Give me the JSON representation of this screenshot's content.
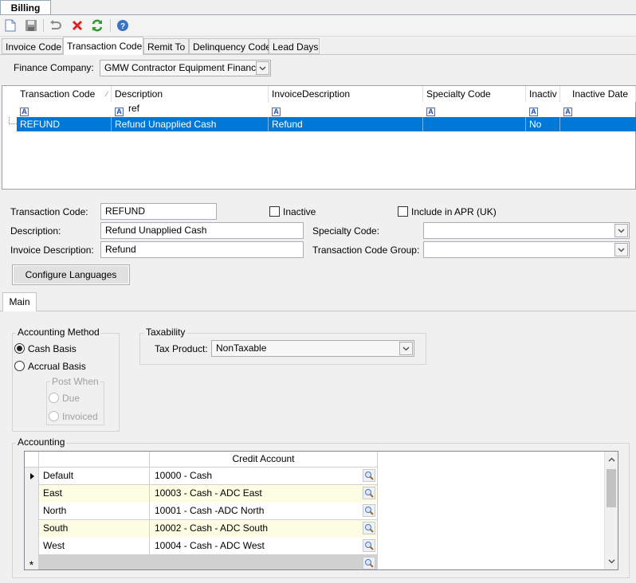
{
  "document_tab": "Billing",
  "toolbar": {
    "icons": [
      "new-icon",
      "save-icon",
      "undo-icon",
      "delete-icon",
      "refresh-icon",
      "help-icon"
    ]
  },
  "tabs": [
    {
      "label": "Invoice Code"
    },
    {
      "label": "Transaction Code",
      "active": true
    },
    {
      "label": "Remit To"
    },
    {
      "label": "Delinquency Code"
    },
    {
      "label": "Lead Days"
    }
  ],
  "finance_company": {
    "label": "Finance Company:",
    "value": "GMW Contractor Equipment Finance"
  },
  "grid": {
    "columns": [
      "Transaction Code",
      "Description",
      "InvoiceDescription",
      "Specialty Code",
      "Inactiv",
      "Inactive Date"
    ],
    "filter": {
      "description": "ref"
    },
    "rows": [
      {
        "transaction_code": "REFUND",
        "description": "Refund Unapplied Cash",
        "invoice_description": "Refund",
        "specialty_code": "",
        "inactive": "No",
        "inactive_date": ""
      }
    ]
  },
  "form": {
    "transaction_code_label": "Transaction Code:",
    "transaction_code": "REFUND",
    "inactive_label": "Inactive",
    "include_apr_label": "Include in APR (UK)",
    "description_label": "Description:",
    "description": "Refund Unapplied Cash",
    "specialty_code_label": "Specialty Code:",
    "specialty_code": "",
    "invoice_description_label": "Invoice Description:",
    "invoice_description": "Refund",
    "transaction_code_group_label": "Transaction Code Group:",
    "transaction_code_group": "",
    "configure_languages": "Configure Languages"
  },
  "subtab": "Main",
  "accounting_method": {
    "title": "Accounting Method",
    "cash_basis": "Cash Basis",
    "accrual_basis": "Accrual Basis",
    "post_when": "Post When",
    "due": "Due",
    "invoiced": "Invoiced"
  },
  "taxability": {
    "title": "Taxability",
    "tax_product_label": "Tax Product:",
    "tax_product": "NonTaxable"
  },
  "accounting": {
    "title": "Accounting",
    "column": "Credit Account",
    "rows": [
      {
        "name": "Default",
        "account": "10000 - Cash"
      },
      {
        "name": "East",
        "account": "10003 - Cash - ADC East"
      },
      {
        "name": "North",
        "account": "10001 - Cash -ADC North"
      },
      {
        "name": "South",
        "account": "10002 - Cash - ADC South"
      },
      {
        "name": "West",
        "account": "10004 - Cash - ADC West"
      }
    ],
    "new_row_marker": "*"
  }
}
